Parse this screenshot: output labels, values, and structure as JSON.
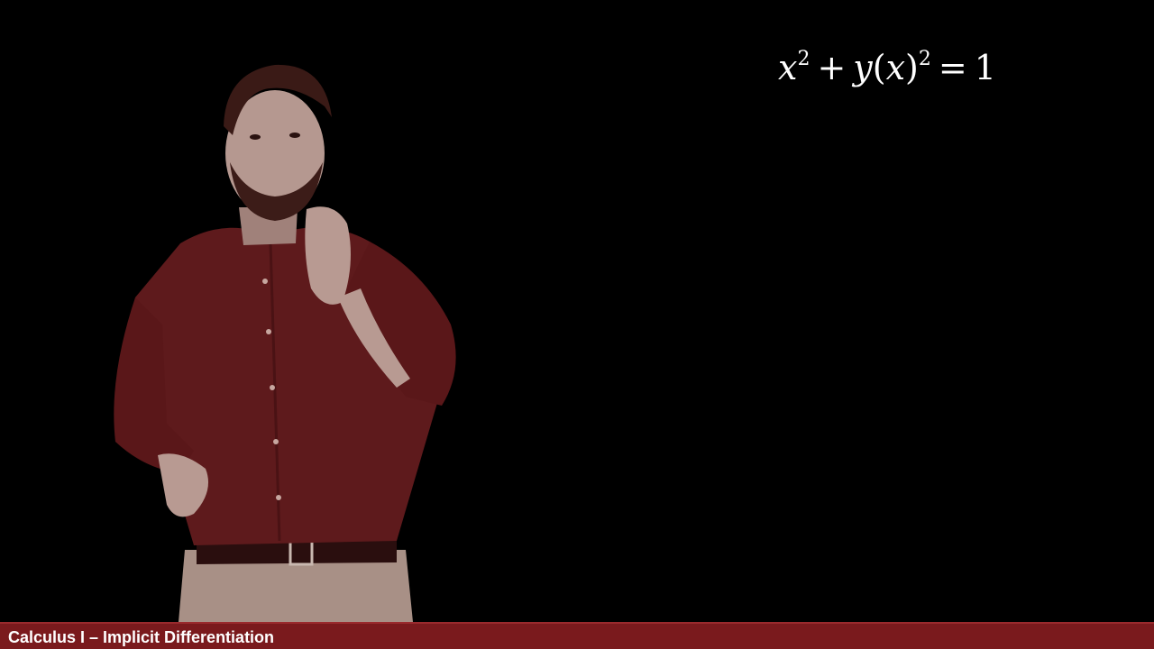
{
  "equation": {
    "x": "x",
    "x_exp": "2",
    "plus": "+",
    "y": "y",
    "open_paren": "(",
    "inner_x": "x",
    "close_paren": ")",
    "y_exp": "2",
    "equals": "=",
    "rhs": "1"
  },
  "footer": {
    "title": "Calculus I – Implicit Differentiation",
    "bar_color": "#7a1a1d"
  },
  "colors": {
    "background": "#000000",
    "shirt": "#5e1a1c",
    "text": "#ffffff"
  }
}
